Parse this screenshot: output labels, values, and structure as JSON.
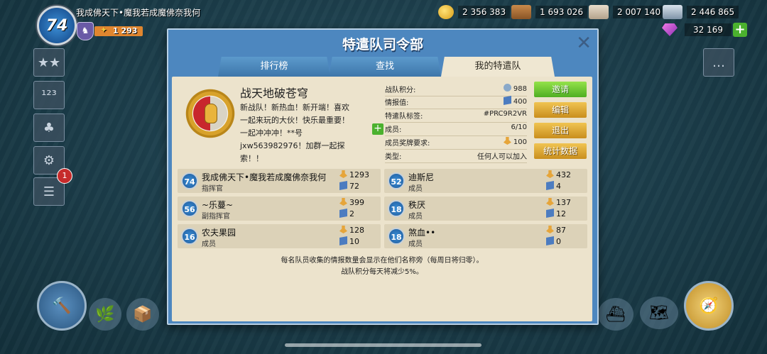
{
  "player": {
    "level": "74",
    "name": "我成佛天下•魔我若成魔佛奈我何",
    "victory_points": "1 293"
  },
  "resources": [
    {
      "name": "gold",
      "icon": "gold-coin-icon",
      "value": "2 356 383"
    },
    {
      "name": "wood",
      "icon": "wood-icon",
      "value": "1 693 026"
    },
    {
      "name": "stone",
      "icon": "stone-icon",
      "value": "2 007 140"
    },
    {
      "name": "iron",
      "icon": "iron-icon",
      "value": "2 446 865"
    }
  ],
  "diamonds": {
    "value": "32 169",
    "add": "+"
  },
  "sidebar_badge": "1",
  "dialog": {
    "title": "特遣队司令部",
    "close": "✕",
    "tabs": [
      "排行榜",
      "查找",
      "我的特遣队"
    ],
    "guild": {
      "name": "战天地破苍穹",
      "description": "新战队！新热血！新开端！喜欢一起来玩的大伙！快乐最重要！一起冲冲冲！**号jxw563982976！加群一起探索！！"
    },
    "stats": [
      {
        "label": "战队积分:",
        "value": "988",
        "icon": "victory-point-icon"
      },
      {
        "label": "情报值:",
        "value": "400",
        "icon": "intel-icon"
      },
      {
        "label": "特遣队标签:",
        "value": "#PRC9R2VR",
        "icon": ""
      },
      {
        "label": "成员:",
        "value": "6/10",
        "icon": ""
      },
      {
        "label": "成员奖牌要求:",
        "value": "100",
        "icon": "medal-icon"
      },
      {
        "label": "类型:",
        "value": "任何人可以加入",
        "icon": ""
      }
    ],
    "buttons": [
      "邀请",
      "编辑",
      "退出",
      "统计数据"
    ],
    "members": [
      {
        "level": "74",
        "name": "我成佛天下•魔我若成魔佛奈我何",
        "rank": "指挥官",
        "vp": "1293",
        "intel": "72"
      },
      {
        "level": "52",
        "name": "迪斯尼",
        "rank": "成员",
        "vp": "432",
        "intel": "4"
      },
      {
        "level": "56",
        "name": "~乐蔓~",
        "rank": "副指挥官",
        "vp": "399",
        "intel": "2"
      },
      {
        "level": "18",
        "name": "秩厌",
        "rank": "成员",
        "vp": "137",
        "intel": "12"
      },
      {
        "level": "16",
        "name": "农夫果园",
        "rank": "成员",
        "vp": "128",
        "intel": "10"
      },
      {
        "level": "18",
        "name": "煞血••",
        "rank": "成员",
        "vp": "87",
        "intel": "0"
      }
    ],
    "footer": [
      "每名队员收集的情报数量会显示在他们名称旁（每周日将归零）。",
      "战队积分每天将减少5%。"
    ]
  }
}
